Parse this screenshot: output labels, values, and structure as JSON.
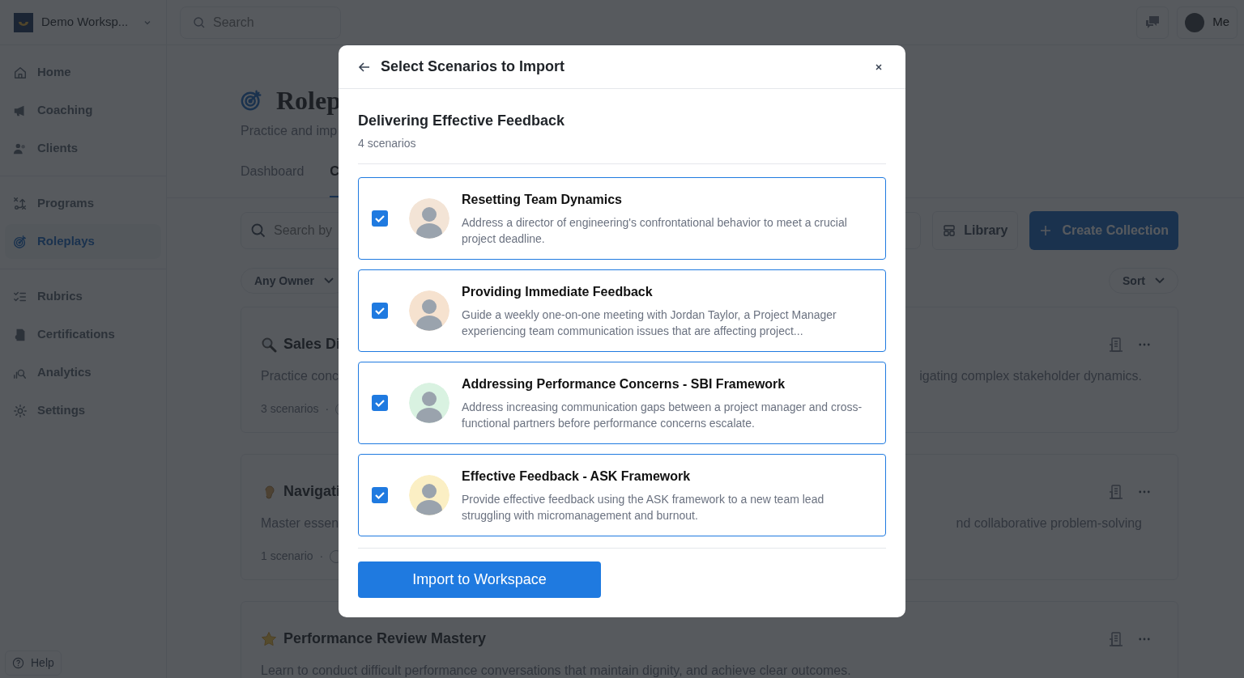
{
  "sidebar": {
    "workspace": "Demo Worksp...",
    "sections": [
      [
        {
          "label": "Home",
          "selected": false
        },
        {
          "label": "Coaching",
          "selected": false
        },
        {
          "label": "Clients",
          "selected": false
        }
      ],
      [
        {
          "label": "Programs",
          "selected": false
        },
        {
          "label": "Roleplays",
          "selected": true
        }
      ],
      [
        {
          "label": "Rubrics",
          "selected": false
        },
        {
          "label": "Certifications",
          "selected": false
        },
        {
          "label": "Analytics",
          "selected": false
        },
        {
          "label": "Settings",
          "selected": false
        }
      ]
    ],
    "help": "Help"
  },
  "topbar": {
    "search_placeholder": "Search",
    "user": "Me"
  },
  "page": {
    "title": "Rolep",
    "subtitle": "Practice and imp",
    "tabs": [
      {
        "label": "Dashboard",
        "selected": false
      },
      {
        "label": "C",
        "selected": true
      }
    ],
    "search_placeholder": "Search by",
    "owner_filter": "Any Owner",
    "library_button": "Library",
    "create_button": "Create Collection",
    "sort": "Sort",
    "collections": [
      {
        "kind": "search",
        "title": "Sales Di",
        "description": "Practice conc",
        "description_end": "igating complex stakeholder dynamics.",
        "count": "3 scenarios",
        "separator": "·"
      },
      {
        "kind": "ear",
        "title": "Navigati",
        "description": "Master essen",
        "description_end": "nd collaborative problem-solving",
        "count": "1 scenario",
        "separator": "·"
      },
      {
        "kind": "star",
        "title": "Performance Review Mastery",
        "description": "Learn to conduct difficult performance conversations that maintain dignity, and achieve clear outcomes."
      }
    ]
  },
  "modal": {
    "title": "Select Scenarios to Import",
    "collection": "Delivering Effective Feedback",
    "count": "4 scenarios",
    "scenarios": [
      {
        "title": "Resetting Team Dynamics",
        "description": "Address a director of engineering's confrontational behavior to meet a crucial project deadline.",
        "checked": true,
        "color": "#f3e4d6"
      },
      {
        "title": "Providing Immediate Feedback",
        "description": "Guide a weekly one-on-one meeting with Jordan Taylor, a Project Manager experiencing team communication issues that are affecting project...",
        "checked": true,
        "color": "#f6e2cf"
      },
      {
        "title": "Addressing Performance Concerns - SBI Framework",
        "description": "Address increasing communication gaps between a project manager and cross-functional partners before performance concerns escalate.",
        "checked": true,
        "color": "#d9f2e1"
      },
      {
        "title": "Effective Feedback - ASK Framework",
        "description": "Provide effective feedback using the ASK framework to a new team lead struggling with micromanagement and burnout.",
        "checked": true,
        "color": "#fbefc4"
      }
    ],
    "import_button": "Import to Workspace"
  }
}
